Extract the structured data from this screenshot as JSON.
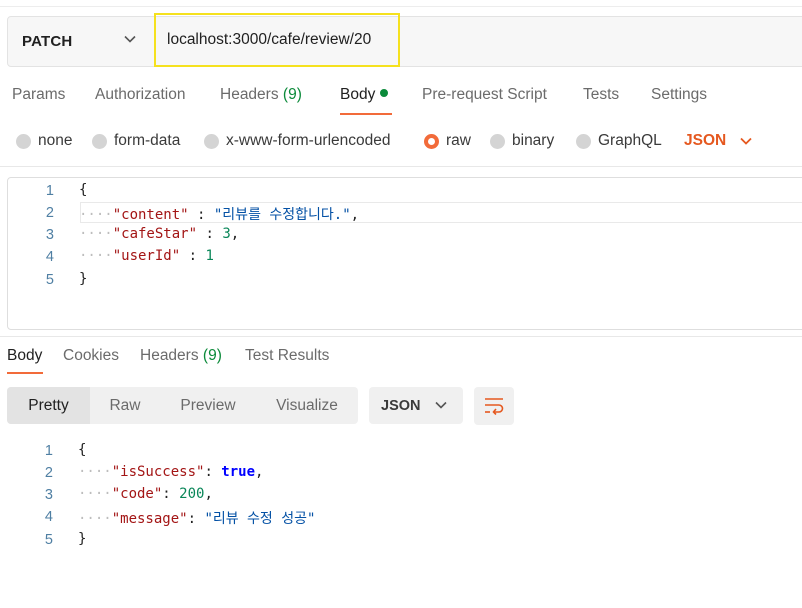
{
  "request": {
    "method": "PATCH",
    "url": "localhost:3000/cafe/review/20"
  },
  "request_tabs": {
    "params": "Params",
    "authorization": "Authorization",
    "headers": "Headers",
    "headers_count": "(9)",
    "body": "Body",
    "prerequest": "Pre-request Script",
    "tests": "Tests",
    "settings": "Settings"
  },
  "body_types": {
    "none": "none",
    "form_data": "form-data",
    "urlencoded": "x-www-form-urlencoded",
    "raw": "raw",
    "binary": "binary",
    "graphql": "GraphQL",
    "selected": "raw",
    "language": "JSON"
  },
  "request_body": {
    "line_numbers": [
      "1",
      "2",
      "3",
      "4",
      "5"
    ],
    "open_brace": "{",
    "close_brace": "}",
    "content_key": "\"content\"",
    "content_val": "\"리뷰를 수정합니다.\"",
    "star_key": "\"cafeStar\"",
    "star_val": "3",
    "user_key": "\"userId\"",
    "user_val": "1"
  },
  "response_tabs": {
    "body": "Body",
    "cookies": "Cookies",
    "headers": "Headers",
    "headers_count": "(9)",
    "test_results": "Test Results"
  },
  "view_modes": {
    "pretty": "Pretty",
    "raw": "Raw",
    "preview": "Preview",
    "visualize": "Visualize",
    "format": "JSON"
  },
  "response_body": {
    "line_numbers": [
      "1",
      "2",
      "3",
      "4",
      "5"
    ],
    "open_brace": "{",
    "close_brace": "}",
    "success_key": "\"isSuccess\"",
    "success_val": "true",
    "code_key": "\"code\"",
    "code_val": "200",
    "message_key": "\"message\"",
    "message_val": "\"리뷰 수정 성공\""
  },
  "colors": {
    "accent": "#f26b3a",
    "json_label": "#e5581f",
    "count_green": "#0b8a3a",
    "highlight_border": "#f5e11e"
  },
  "icons": {
    "method_dropdown": "chevron-down-icon",
    "language_dropdown": "chevron-down-icon",
    "format_dropdown": "chevron-down-icon",
    "wrap": "wrap-lines-icon"
  }
}
